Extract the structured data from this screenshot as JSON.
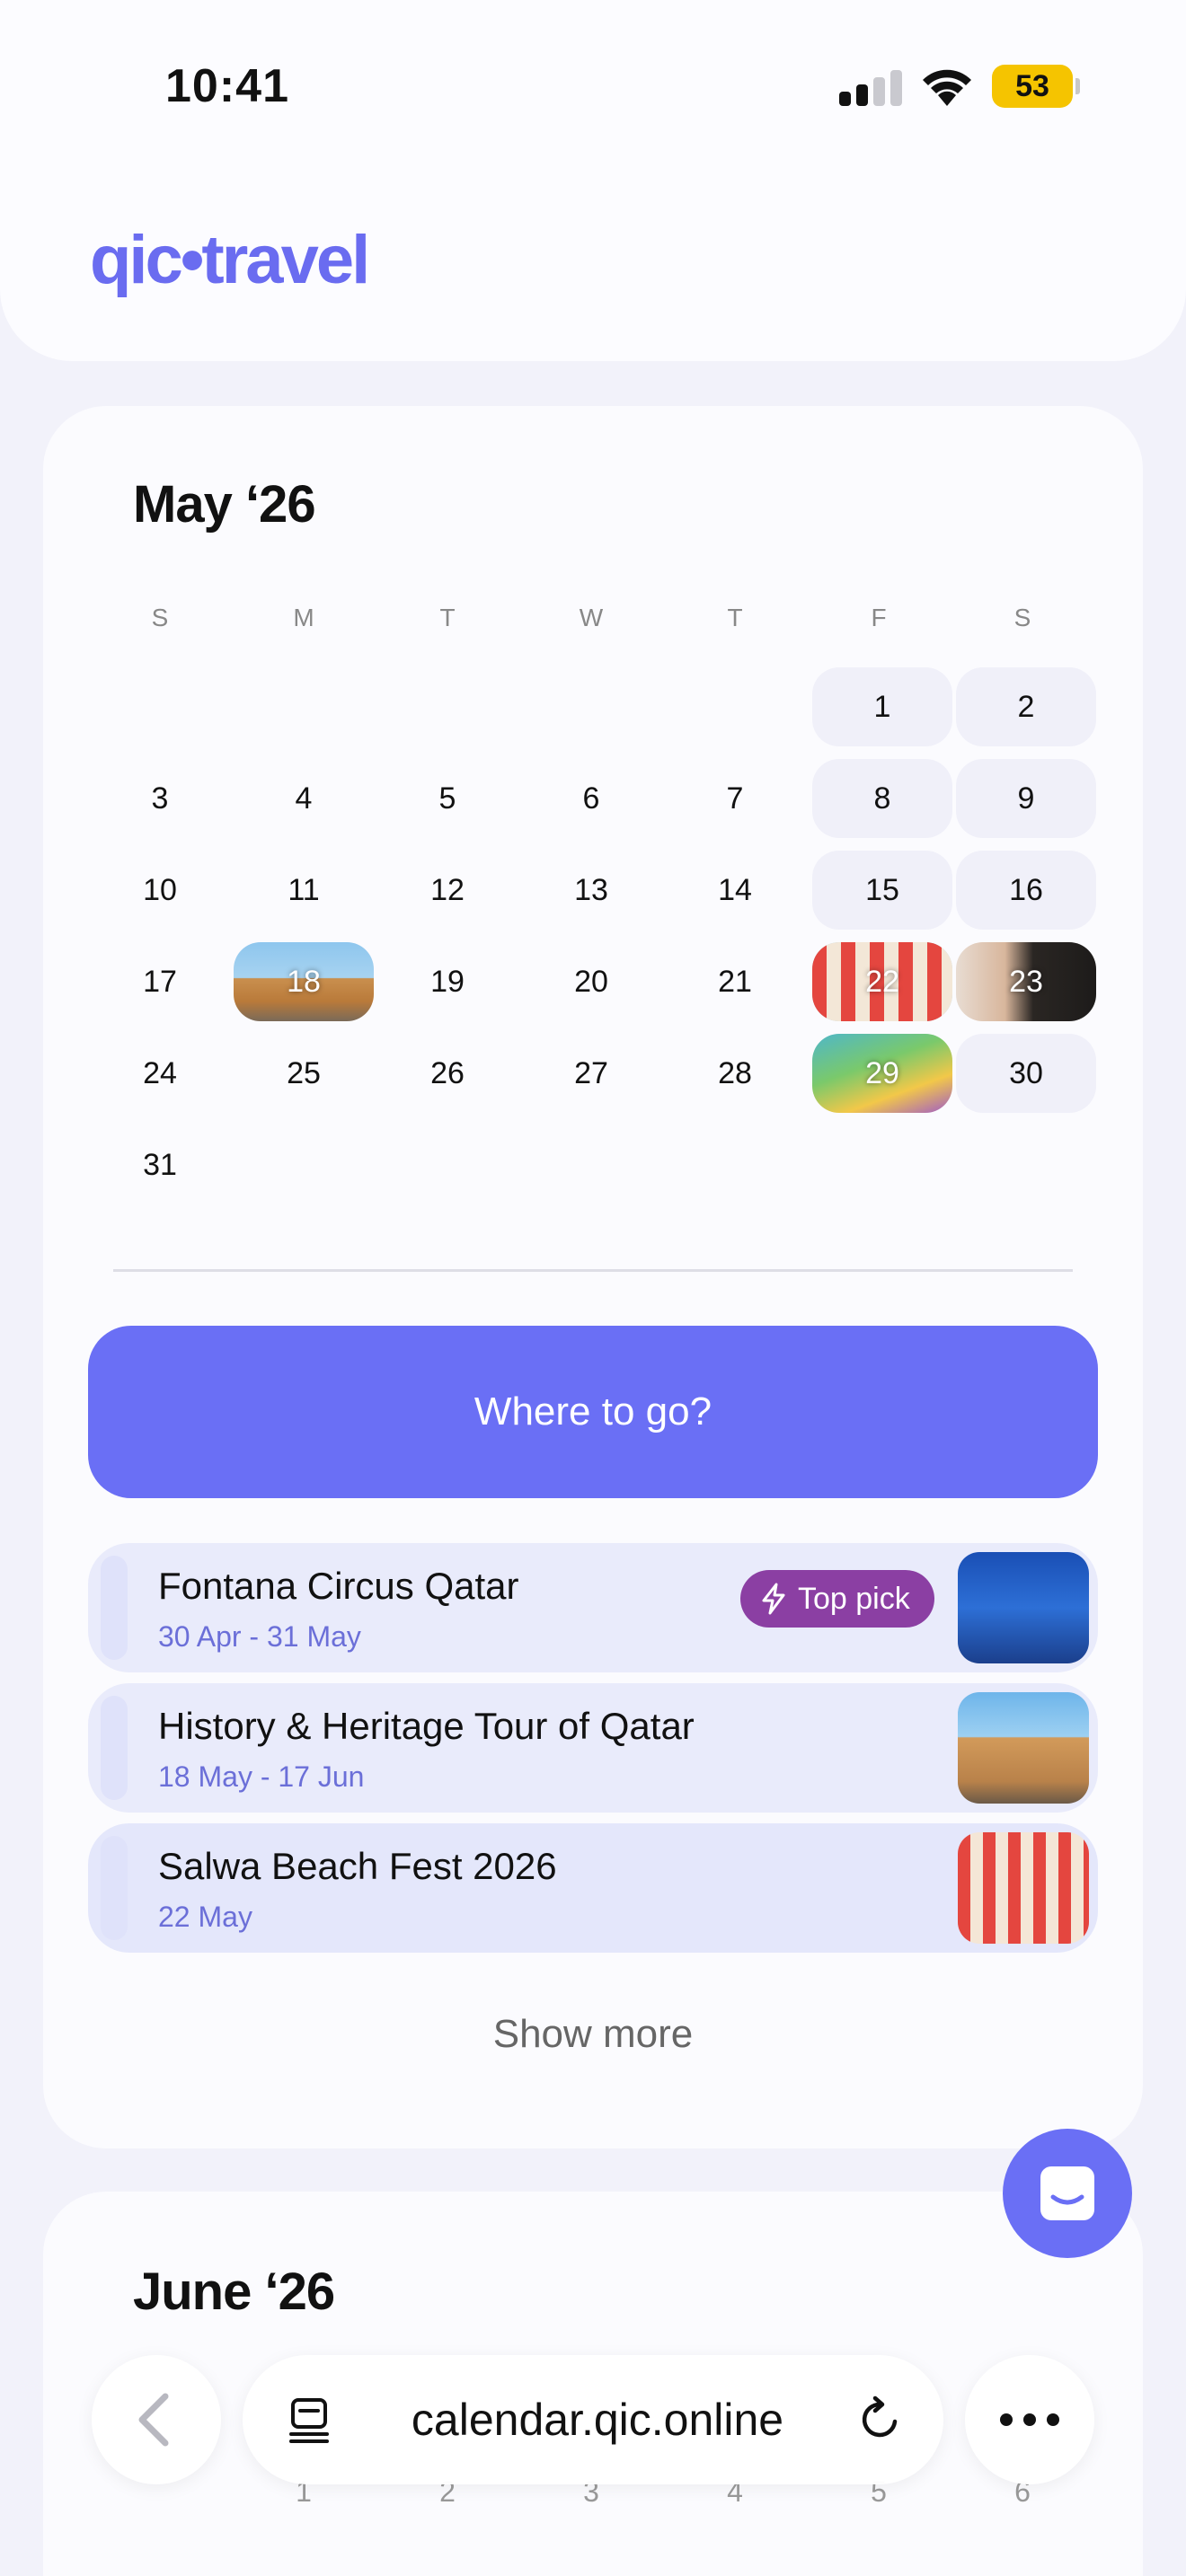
{
  "status": {
    "time": "10:41",
    "battery": "53"
  },
  "header": {
    "logo": "qic•travel"
  },
  "calendar": {
    "month": "May ‘26",
    "weekdays": [
      "S",
      "M",
      "T",
      "W",
      "T",
      "F",
      "S"
    ],
    "days": [
      "1",
      "2",
      "3",
      "4",
      "5",
      "6",
      "7",
      "8",
      "9",
      "10",
      "11",
      "12",
      "13",
      "14",
      "15",
      "16",
      "17",
      "18",
      "19",
      "20",
      "21",
      "22",
      "23",
      "24",
      "25",
      "26",
      "27",
      "28",
      "29",
      "30",
      "31"
    ]
  },
  "cta": {
    "label": "Where to go?"
  },
  "events": [
    {
      "title": "Fontana Circus Qatar",
      "dates": "30 Apr - 31 May",
      "badge": "Top pick"
    },
    {
      "title": "History & Heritage Tour of Qatar",
      "dates": "18 May - 17 Jun"
    },
    {
      "title": "Salwa Beach Fest 2026",
      "dates": "22 May"
    }
  ],
  "show_more": "Show more",
  "next_month": {
    "title": "June ‘26",
    "days": [
      "1",
      "2",
      "3",
      "4",
      "5",
      "6"
    ]
  },
  "browser": {
    "url": "calendar.qic.online"
  },
  "colors": {
    "accent": "#6a6ff5",
    "badge": "#8b3fa3",
    "battery": "#f5c400"
  }
}
